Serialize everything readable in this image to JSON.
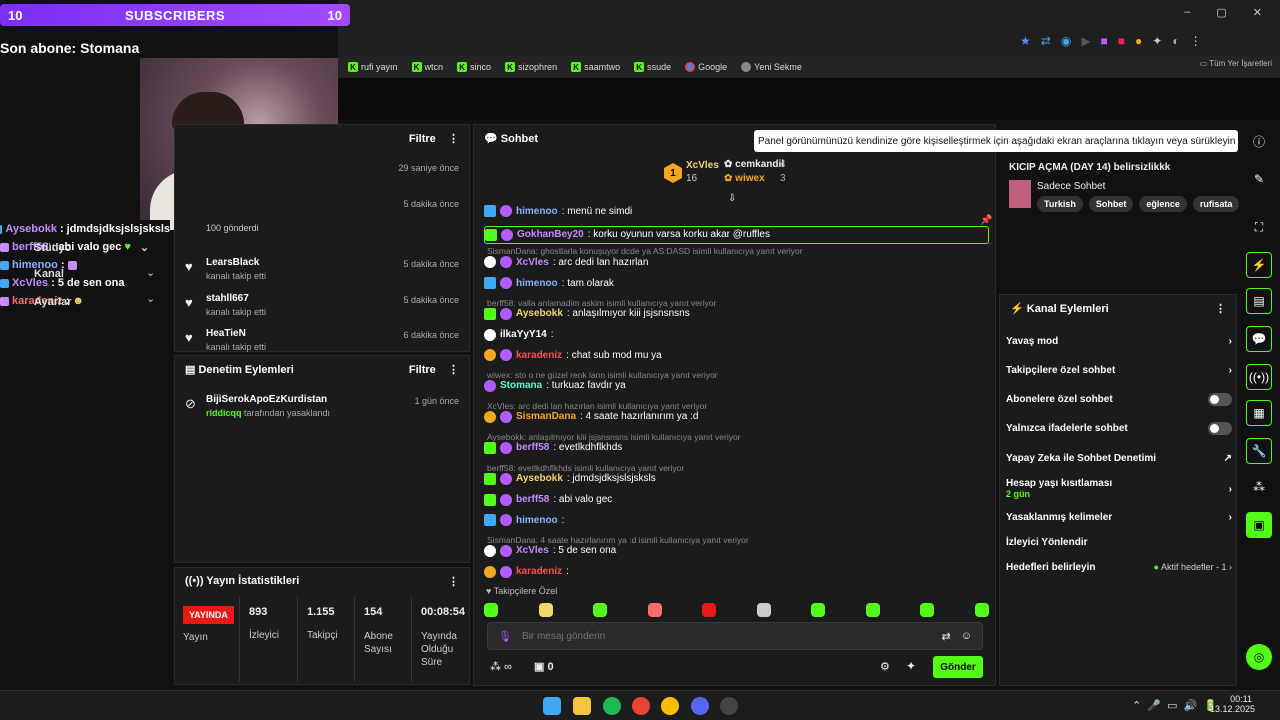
{
  "overlay": {
    "sub_left": "10",
    "sub_title": "SUBSCRIBERS",
    "sub_right": "10",
    "last_sub": "Son abone: Stomana",
    "chat": [
      {
        "user": "Aysebokk",
        "text": ": jdmdsjdksjslsjsksls"
      },
      {
        "user": "berff58",
        "text": ": abi valo gec"
      },
      {
        "user": "himenoo",
        "text": " :"
      },
      {
        "user": "XcVles",
        "text": ": 5 de sen ona"
      },
      {
        "user": "karadeniz",
        "text": " :"
      }
    ],
    "side_labels": {
      "studio": "Stüdyo",
      "channel": "Kanal",
      "settings": "Ayarlar"
    }
  },
  "bookmarks": [
    "rufi yayın",
    "wtcn",
    "sinco",
    "sizophren",
    "saamtwo",
    "ssude",
    "Google",
    "Yeni Sekme"
  ],
  "all_bookmarks": "Tüm Yer İşaretleri",
  "activity": {
    "filter": "Filtre",
    "items": [
      {
        "name": "",
        "sub": "",
        "time": "29 saniye önce"
      },
      {
        "name": "",
        "sub": "100 gönderdi",
        "time": "5 dakika önce"
      },
      {
        "name": "LearsBlack",
        "sub": "kanalı takip etti",
        "time": "5 dakika önce"
      },
      {
        "name": "stahll667",
        "sub": "kanalı takip etti",
        "time": "5 dakika önce"
      },
      {
        "name": "HeaTieN",
        "sub": "kanalı takip etti",
        "time": "6 dakika önce"
      }
    ]
  },
  "moderation": {
    "title": "Denetim Eylemleri",
    "filter": "Filtre",
    "item_name": "BijiSerokApoEzKurdistan",
    "item_user": "riddicqq",
    "item_sub": " tarafından yasaklandı",
    "item_time": "1 gün önce"
  },
  "stats": {
    "title": "Yayın İstatistikleri",
    "live": "YAYINDA",
    "live_label": "Yayın",
    "cols": [
      {
        "value": "893",
        "label": "İzleyici"
      },
      {
        "value": "1.155",
        "label": "Takipçi"
      },
      {
        "value": "154",
        "label": "Abone Sayısı"
      },
      {
        "value": "00:08:54",
        "label": "Yayında Olduğu Süre"
      }
    ]
  },
  "chat": {
    "title": "Sohbet",
    "leaderboard": [
      {
        "rank": "1",
        "name": "XcVles",
        "count": "16"
      },
      {
        "rank": "",
        "name": "cemkandil",
        "count": "4"
      },
      {
        "rank": "",
        "name": "wiwex",
        "count": "3"
      }
    ],
    "messages": [
      {
        "reply": "",
        "user": "himenoo",
        "color": "#8ab4ff",
        "text": ": menü ne simdi"
      },
      {
        "reply": "",
        "user": "GokhanBey20",
        "color": "#c58bff",
        "text": ": korku oyunun varsa korku akar @ruffles"
      },
      {
        "reply": "SismanDana: ghostlarla konuşuyor dcde ya AS:DASD isimli kullanıcıya yanıt veriyor",
        "user": "XcVles",
        "color": "#c58bff",
        "text": ": arc dedi lan hazırlan"
      },
      {
        "reply": "",
        "user": "himenoo",
        "color": "#8ab4ff",
        "text": ": tam olarak"
      },
      {
        "reply": "berff58: valla anlamadim askim isimli kullanıcıya yanıt veriyor",
        "user": "Aysebokk",
        "color": "#f5d76e",
        "text": ": anlaşılmıyor kiii jsjsnsnsns"
      },
      {
        "reply": "",
        "user": "ilkaYyY14",
        "color": "#ffffff",
        "text": ":"
      },
      {
        "reply": "",
        "user": "karadeniz",
        "color": "#ff4d4d",
        "text": ": chat sub mod mu ya"
      },
      {
        "reply": "wiwex: sto o ne güzel renk lann isimli kullanıcıya yanıt veriyor",
        "user": "Stomana",
        "color": "#53fcd0",
        "text": ": turkuaz favdır ya"
      },
      {
        "reply": "XcVles: arc dedi lan hazırlan isimli kullanıcıya yanıt veriyor",
        "user": "SismanDana",
        "color": "#f5a623",
        "text": ": 4 saate hazırlanırım ya :d"
      },
      {
        "reply": "Aysebokk: anlaşılmıyor kiii jsjsnsnsns isimli kullanıcıya yanıt veriyor",
        "user": "berff58",
        "color": "#c58bff",
        "text": ": evetlkdhflkhds"
      },
      {
        "reply": "berff58: evetlkdhflkhds isimli kullanıcıya yanıt veriyor",
        "user": "Aysebokk",
        "color": "#f5d76e",
        "text": ": jdmdsjdksjslsjsksls"
      },
      {
        "reply": "",
        "user": "berff58",
        "color": "#c58bff",
        "text": ": abi valo gec"
      },
      {
        "reply": "",
        "user": "himenoo",
        "color": "#8ab4ff",
        "text": ":"
      },
      {
        "reply": "SismanDana: 4 saate hazırlanırım ya :d isimli kullanıcıya yanıt veriyor",
        "user": "XcVles",
        "color": "#c58bff",
        "text": ": 5 de sen ona"
      },
      {
        "reply": "",
        "user": "karadeniz",
        "color": "#ff4d4d",
        "text": ":"
      }
    ],
    "followers_only": "Takipçilere Özel",
    "input_placeholder": "Bir mesaj gönderin",
    "kicks": "0",
    "send": "Gönder"
  },
  "tooltip": "Panel görünümünüzü kendinize göre kişiselleştirmek için aşağıdaki ekran araçlarına tıklayın veya sürükleyin",
  "stream_info": {
    "title": "KICIP AÇMA (DAY 14) belirsizlikkk",
    "category": "Sadece Sohbet",
    "tags": [
      "Turkish",
      "Sohbet",
      "eğlence",
      "rufisata"
    ]
  },
  "channel_actions": {
    "title": "Kanal Eylemleri",
    "items": [
      {
        "label": "Yavaş mod",
        "sub": "",
        "ctl": "chevron"
      },
      {
        "label": "Takipçilere özel sohbet",
        "sub": "",
        "ctl": "chevron"
      },
      {
        "label": "Abonelere özel sohbet",
        "sub": "",
        "ctl": "toggle"
      },
      {
        "label": "Yalnızca ifadelerle sohbet",
        "sub": "",
        "ctl": "toggle"
      },
      {
        "label": "Yapay Zeka ile Sohbet Denetimi",
        "sub": "",
        "ctl": "external"
      },
      {
        "label": "Hesap yaşı kısıtlaması",
        "sub": "2 gün",
        "ctl": "chevron"
      },
      {
        "label": "Yasaklanmış kelimeler",
        "sub": "",
        "ctl": "chevron"
      },
      {
        "label": "İzleyici Yönlendir",
        "sub": "",
        "ctl": "none"
      },
      {
        "label": "Hedefleri belirleyin",
        "sub": "",
        "ctl": "chevron"
      }
    ],
    "goals_status": "Aktif hedefler - 1"
  },
  "taskbar": {
    "time": "00:11",
    "date": "13.12.2025"
  },
  "colors": {
    "accent": "#53fc18",
    "purple": "#7b2ff7",
    "live": "#e91916"
  }
}
